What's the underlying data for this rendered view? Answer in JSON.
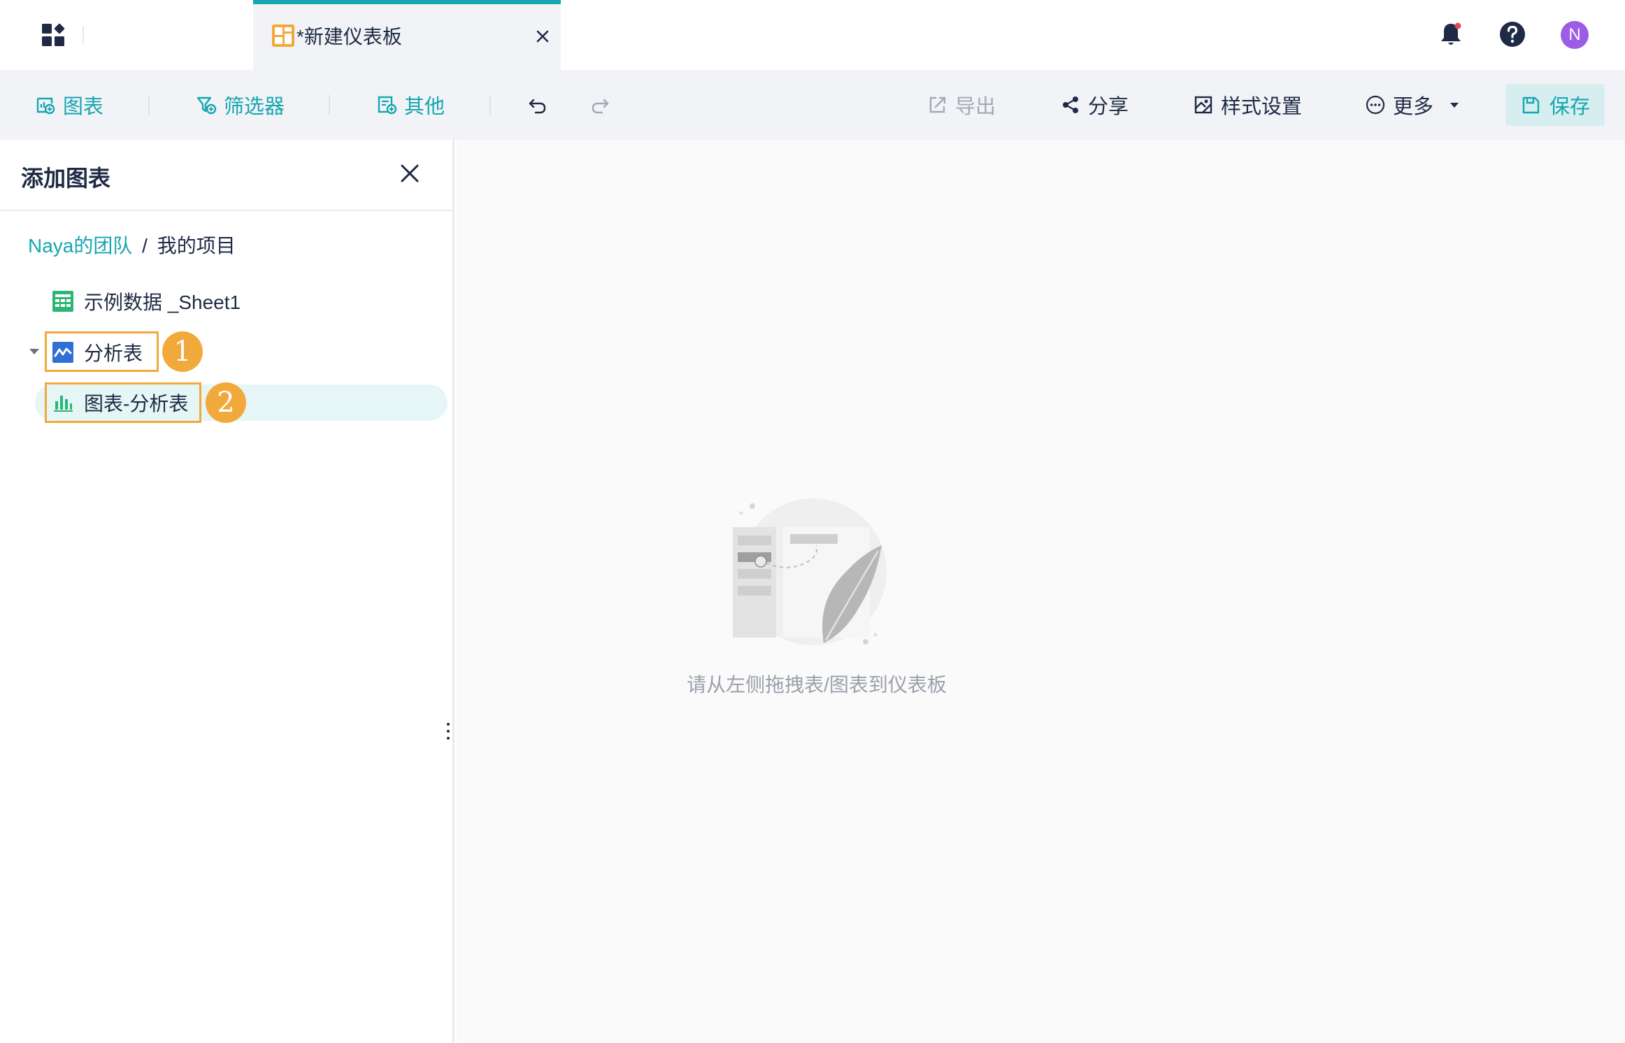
{
  "tab": {
    "title": "*新建仪表板",
    "icon": "dashboard-tab-icon"
  },
  "top_icons": {
    "app_grid": "apps-grid-icon",
    "notifications": "bell-icon",
    "help": "help-icon",
    "avatar_letter": "N"
  },
  "toolbar": {
    "chart_label": "图表",
    "filter_label": "筛选器",
    "other_label": "其他",
    "export_label": "导出",
    "share_label": "分享",
    "style_label": "样式设置",
    "more_label": "更多",
    "save_label": "保存"
  },
  "panel": {
    "title": "添加图表",
    "breadcrumb": {
      "team": "Naya的团队",
      "separator": "/",
      "project": "我的项目"
    },
    "tree": {
      "sheet": "示例数据 _Sheet1",
      "analysis": "分析表",
      "chart": "图表-分析表"
    },
    "annotations": [
      "1",
      "2"
    ]
  },
  "canvas": {
    "empty_hint": "请从左侧拖拽表/图表到仪表板"
  },
  "colors": {
    "accent": "#15a6b0",
    "annotation": "#f2a93b",
    "text": "#1f2a44",
    "avatar": "#9b5de5",
    "sheet_green": "#2bb673",
    "analysis_blue": "#2f6fd6"
  }
}
